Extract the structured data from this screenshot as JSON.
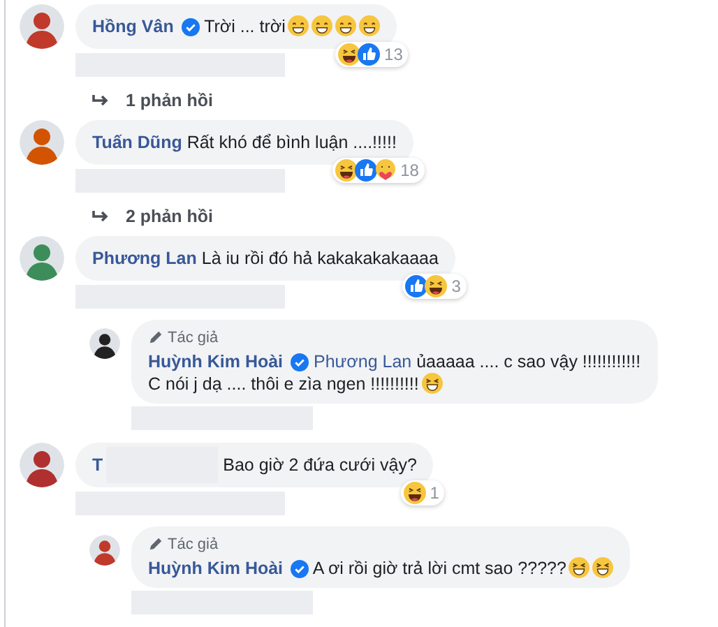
{
  "comments": [
    {
      "author": "Hồng Vân",
      "verified": true,
      "text": "Trời ... trời",
      "emoji": [
        {
          "kind": "smile"
        },
        {
          "kind": "smile"
        },
        {
          "kind": "smile"
        },
        {
          "kind": "smile"
        }
      ],
      "reactions": {
        "types": [
          {
            "kind": "haha"
          },
          {
            "kind": "like"
          }
        ],
        "count": "13"
      },
      "replies_link": "1 phản hồi"
    },
    {
      "author": "Tuấn Dũng",
      "verified": false,
      "text": "Rất khó để bình luận ....!!!!!",
      "reactions": {
        "types": [
          {
            "kind": "haha"
          },
          {
            "kind": "like"
          },
          {
            "kind": "care"
          }
        ],
        "count": "18"
      },
      "replies_link": "2 phản hồi"
    },
    {
      "author": "Phương Lan",
      "verified": false,
      "text": "Là iu rồi đó hả kakakakakaaaa",
      "reactions": {
        "types": [
          {
            "kind": "like"
          },
          {
            "kind": "haha"
          }
        ],
        "count": "3"
      },
      "replies": [
        {
          "author_badge": "Tác giả",
          "author": "Huỳnh Kim Hoài",
          "verified": true,
          "mention": "Phương Lan",
          "text": "ủaaaaa .... c sao vậy !!!!!!!!!!!!\nC nói j dạ .... thôi e zìa ngen !!!!!!!!!!",
          "emoji": [
            {
              "kind": "laugh"
            }
          ]
        }
      ]
    },
    {
      "author": "T",
      "author_redacted": true,
      "verified": false,
      "text": "Bao giờ 2 đứa cưới vậy?",
      "reactions": {
        "types": [
          {
            "kind": "haha"
          }
        ],
        "count": "1"
      },
      "replies": [
        {
          "author_badge": "Tác giả",
          "author": "Huỳnh Kim Hoài",
          "verified": true,
          "text": "A ơi rồi giờ trả lời cmt sao ?????",
          "emoji": [
            {
              "kind": "laugh"
            },
            {
              "kind": "laugh"
            }
          ]
        }
      ]
    }
  ]
}
